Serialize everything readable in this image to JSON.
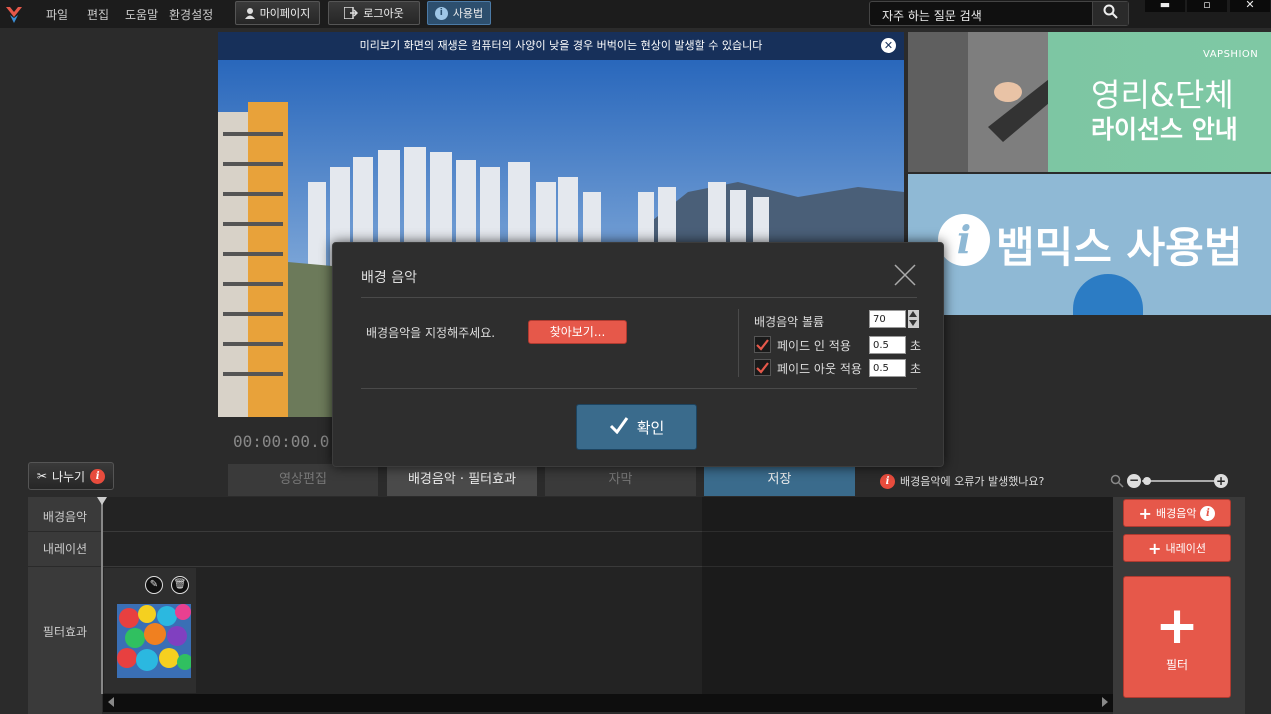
{
  "menu": {
    "file": "파일",
    "edit": "편집",
    "help": "도움말",
    "settings": "환경설정"
  },
  "toolbar": {
    "mypage": "마이페이지",
    "logout": "로그아웃",
    "howto": "사용법"
  },
  "search": {
    "placeholder": "자주 하는 질문 검색"
  },
  "preview": {
    "notice": "미리보기 화면의 재생은 컴퓨터의 사양이 낮을 경우 버벅이는 현상이 발생할 수 있습니다",
    "timecode": "00:00:00.0"
  },
  "ads": {
    "brand": "VAPSHION",
    "license_line1": "영리&단체",
    "license_line2": "라이선스 안내",
    "howto_title": "뱁믹스 사용법"
  },
  "dialog": {
    "title": "배경 음악",
    "prompt": "배경음악을 지정해주세요.",
    "browse": "찾아보기...",
    "volume_label": "배경음악 볼륨",
    "volume_value": "70",
    "fade_in_label": "페이드 인 적용",
    "fade_in_value": "0.5",
    "fade_out_label": "페이드 아웃 적용",
    "fade_out_value": "0.5",
    "unit": "초",
    "ok": "확인",
    "fade_in_checked": true,
    "fade_out_checked": true
  },
  "tabs": {
    "split": "나누기",
    "video_edit": "영상편집",
    "bgm_filter": "배경음악 · 필터효과",
    "subtitle": "자막",
    "save": "저장",
    "error_note": "배경음악에 오류가 발생했나요?"
  },
  "timeline": {
    "rows": [
      "배경음악",
      "내레이션",
      "필터효과"
    ]
  },
  "side": {
    "add_bgm": "배경음악",
    "add_narration": "내레이션",
    "add_filter": "필터"
  },
  "colors": {
    "accent_red": "#e6584a",
    "accent_blue": "#3a6b8c",
    "active_tab": "#3a6b8c"
  }
}
